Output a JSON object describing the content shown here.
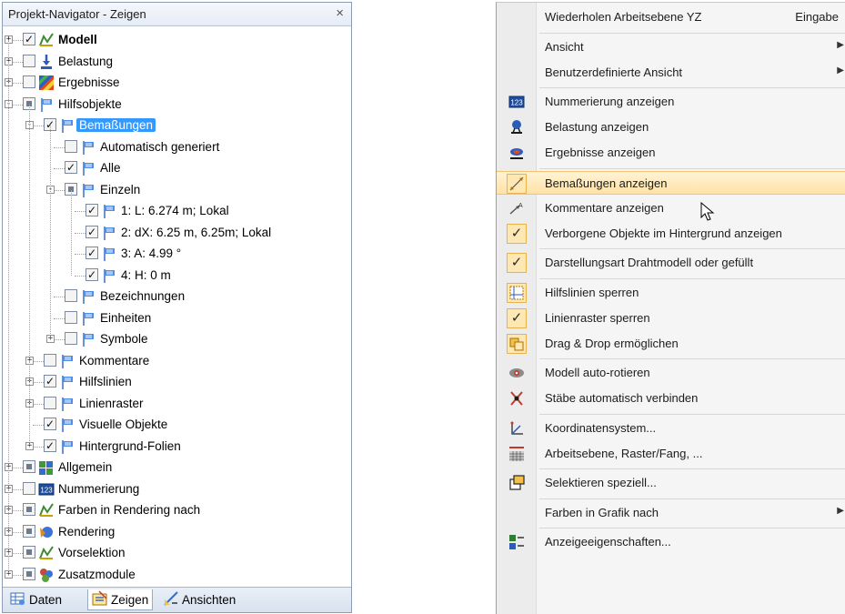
{
  "navigator": {
    "title": "Projekt-Navigator - Zeigen",
    "close_glyph": "×",
    "tree": [
      {
        "id": "modell",
        "label": "Modell",
        "bold": true,
        "toggle": "+",
        "check": "checked",
        "icon": "model-icon"
      },
      {
        "id": "belastung",
        "label": "Belastung",
        "toggle": "+",
        "check": "unchecked",
        "icon": "load-icon"
      },
      {
        "id": "ergebnisse",
        "label": "Ergebnisse",
        "toggle": "+",
        "check": "unchecked",
        "icon": "results-icon"
      },
      {
        "id": "hilfsobjekte",
        "label": "Hilfsobjekte",
        "toggle": "-",
        "check": "partial",
        "icon": "flag-icon"
      },
      {
        "id": "bemassungen",
        "label": "Bemaßungen",
        "toggle": "-",
        "check": "checked",
        "icon": "flag-icon",
        "selected": true
      },
      {
        "id": "automatisch",
        "label": "Automatisch generiert",
        "check": "unchecked",
        "icon": "flag-icon"
      },
      {
        "id": "alle",
        "label": "Alle",
        "check": "checked",
        "icon": "flag-icon"
      },
      {
        "id": "einzeln",
        "label": "Einzeln",
        "toggle": "-",
        "check": "partial",
        "icon": "flag-icon"
      },
      {
        "id": "dim1",
        "label": "1: L: 6.274 m; Lokal",
        "check": "checked",
        "icon": "flag-icon"
      },
      {
        "id": "dim2",
        "label": "2: dX: 6.25 m, 6.25m; Lokal",
        "check": "checked",
        "icon": "flag-icon"
      },
      {
        "id": "dim3",
        "label": "3: A: 4.99 °",
        "check": "checked",
        "icon": "flag-icon"
      },
      {
        "id": "dim4",
        "label": "4: H: 0 m",
        "check": "checked",
        "icon": "flag-icon"
      },
      {
        "id": "bezeichnungen",
        "label": "Bezeichnungen",
        "check": "unchecked",
        "icon": "flag-icon"
      },
      {
        "id": "einheiten",
        "label": "Einheiten",
        "check": "unchecked",
        "icon": "flag-icon"
      },
      {
        "id": "symbole",
        "label": "Symbole",
        "toggle": "+",
        "check": "unchecked",
        "icon": "flag-icon"
      },
      {
        "id": "kommentare",
        "label": "Kommentare",
        "toggle": "+",
        "check": "unchecked",
        "icon": "flag-icon"
      },
      {
        "id": "hilfslinien",
        "label": "Hilfslinien",
        "toggle": "+",
        "check": "checked",
        "icon": "flag-icon"
      },
      {
        "id": "linienraster",
        "label": "Linienraster",
        "toggle": "+",
        "check": "unchecked",
        "icon": "flag-icon"
      },
      {
        "id": "visuelle",
        "label": "Visuelle Objekte",
        "check": "checked",
        "icon": "flag-icon"
      },
      {
        "id": "hintergrund",
        "label": "Hintergrund-Folien",
        "toggle": "+",
        "check": "checked",
        "icon": "flag-icon"
      },
      {
        "id": "allgemein",
        "label": "Allgemein",
        "toggle": "+",
        "check": "partial",
        "icon": "general-icon"
      },
      {
        "id": "nummerierung",
        "label": "Nummerierung",
        "toggle": "+",
        "check": "unchecked",
        "icon": "numbering-icon"
      },
      {
        "id": "farben",
        "label": "Farben in Rendering nach",
        "toggle": "+",
        "check": "partial",
        "icon": "model-icon"
      },
      {
        "id": "rendering",
        "label": "Rendering",
        "toggle": "+",
        "check": "partial",
        "icon": "rendering-icon"
      },
      {
        "id": "vorselektion",
        "label": "Vorselektion",
        "toggle": "+",
        "check": "partial",
        "icon": "model-icon"
      },
      {
        "id": "zusatzmodule",
        "label": "Zusatzmodule",
        "toggle": "+",
        "check": "partial",
        "icon": "addon-icon"
      }
    ],
    "tabs": [
      {
        "label": "Daten",
        "icon": "data-icon"
      },
      {
        "label": "Zeigen",
        "icon": "display-icon",
        "active": true
      },
      {
        "label": "Ansichten",
        "icon": "views-icon"
      }
    ]
  },
  "menu": {
    "items": [
      {
        "label": "Wiederholen Arbeitsebene YZ",
        "shortcut": "Eingabe"
      },
      {
        "sep": true
      },
      {
        "label": "Ansicht",
        "submenu": true
      },
      {
        "label": "Benutzerdefinierte Ansicht",
        "submenu": true
      },
      {
        "sep": true
      },
      {
        "label": "Nummerierung anzeigen",
        "icon": "numbering-icon"
      },
      {
        "label": "Belastung anzeigen",
        "icon": "load-display-icon"
      },
      {
        "label": "Ergebnisse anzeigen",
        "icon": "results-display-icon"
      },
      {
        "sep": true
      },
      {
        "label": "Bemaßungen anzeigen",
        "icon": "dimension-icon",
        "highlight": true,
        "checkframe": true
      },
      {
        "label": "Kommentare anzeigen",
        "icon": "comment-icon"
      },
      {
        "label": "Verborgene Objekte im Hintergrund anzeigen",
        "icon": "check-icon",
        "checked": true
      },
      {
        "sep": true
      },
      {
        "label": "Darstellungsart Drahtmodell oder gefüllt",
        "icon": "check-icon",
        "checked": true
      },
      {
        "sep": true
      },
      {
        "label": "Hilfslinien sperren",
        "icon": "guideline-lock-icon",
        "checkframe": true
      },
      {
        "label": "Linienraster sperren",
        "icon": "check-icon",
        "checked": true
      },
      {
        "label": "Drag & Drop ermöglichen",
        "icon": "drag-drop-icon",
        "checkframe": true
      },
      {
        "sep": true
      },
      {
        "label": "Modell auto-rotieren",
        "icon": "rotate-icon"
      },
      {
        "label": "Stäbe automatisch verbinden",
        "icon": "connect-icon"
      },
      {
        "sep": true
      },
      {
        "label": "Koordinatensystem...",
        "icon": "coordinate-icon"
      },
      {
        "label": "Arbeitsebene, Raster/Fang, ...",
        "icon": "grid-icon"
      },
      {
        "sep": true
      },
      {
        "label": "Selektieren speziell...",
        "icon": "select-icon"
      },
      {
        "sep": true
      },
      {
        "label": "Farben in Grafik nach",
        "submenu": true
      },
      {
        "sep": true
      },
      {
        "label": "Anzeigeeigenschaften...",
        "icon": "properties-icon"
      }
    ],
    "check_glyph": "✓",
    "submenu_glyph": "▶"
  },
  "colors": {
    "selection": "#3399ff",
    "menu_highlight": "#ffe2a4",
    "check_frame": "#fde7b3"
  }
}
